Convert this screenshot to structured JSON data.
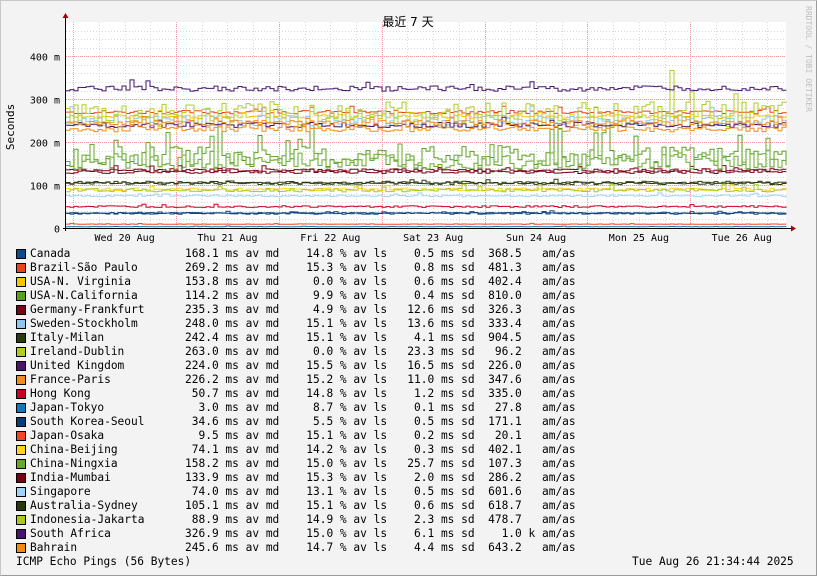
{
  "chart_data": {
    "type": "line",
    "title": "最近 7 天",
    "ylabel": "Seconds",
    "watermark": "RRDTOOL / TOBI OETIKER",
    "y_ticks": [
      "0",
      "100 m",
      "200 m",
      "300 m",
      "400 m"
    ],
    "ylim": [
      0,
      0.48
    ],
    "x_ticks": [
      "Wed 20 Aug",
      "Thu 21 Aug",
      "Fri 22 Aug",
      "Sat 23 Aug",
      "Sun 24 Aug",
      "Mon 25 Aug",
      "Tue 26 Aug"
    ],
    "grid": true,
    "legend_position": "bottom",
    "series": [
      {
        "name": "Canada",
        "color": "#0d4b8c",
        "text": "168.1 ms av md    14.8 % av ls    0.5 ms sd  368.5   am/as",
        "base": 0.034,
        "noise": 0.002
      },
      {
        "name": "Brazil-São Paulo",
        "color": "#e8441c",
        "text": "269.2 ms av md    15.3 % av ls    0.8 ms sd  481.3   am/as",
        "base": 0.27,
        "noise": 0.004
      },
      {
        "name": "USA-N. Virginia",
        "color": "#f0c800",
        "text": "153.8 ms av md     0.0 % av ls    0.6 ms sd  402.4   am/as",
        "base": 0.26,
        "noise": 0.004
      },
      {
        "name": "USA-N.California",
        "color": "#5aa01e",
        "text": "114.2 ms av md     9.9 % av ls    0.4 ms sd  810.0   am/as",
        "base": 0.165,
        "noise": 0.025
      },
      {
        "name": "Germany-Frankfurt",
        "color": "#7d0018",
        "text": "235.3 ms av md     4.9 % av ls   12.6 ms sd  326.3   am/as",
        "base": 0.135,
        "noise": 0.003
      },
      {
        "name": "Sweden-Stockholm",
        "color": "#8ec6f0",
        "text": "248.0 ms av md    15.1 % av ls   13.6 ms sd  333.4   am/as",
        "base": 0.25,
        "noise": 0.012
      },
      {
        "name": "Italy-Milan",
        "color": "#2b3c0c",
        "text": "242.4 ms av md    15.1 % av ls    4.1 ms sd  904.5   am/as",
        "base": 0.105,
        "noise": 0.004
      },
      {
        "name": "Ireland-Dublin",
        "color": "#b2cc20",
        "text": "263.0 ms av md     0.0 % av ls   23.3 ms sd   96.2   am/as",
        "base": 0.265,
        "noise": 0.03
      },
      {
        "name": "United Kingdom",
        "color": "#4b1464",
        "text": "224.0 ms av md    15.5 % av ls   16.5 ms sd  226.0   am/as",
        "base": 0.24,
        "noise": 0.006
      },
      {
        "name": "France-Paris",
        "color": "#f08c1e",
        "text": "226.2 ms av md    15.2 % av ls   11.0 ms sd  347.6   am/as",
        "base": 0.245,
        "noise": 0.006
      },
      {
        "name": "Hong Kong",
        "color": "#c8001e",
        "text": " 50.7 ms av md    14.8 % av ls    1.2 ms sd  335.0   am/as",
        "base": 0.05,
        "noise": 0.002
      },
      {
        "name": "Japan-Tokyo",
        "color": "#1478b4",
        "text": "  3.0 ms av md     8.7 % av ls    0.1 ms sd   27.8   am/as",
        "base": 0.003,
        "noise": 0.0005
      },
      {
        "name": "South Korea-Seoul",
        "color": "#0a3c78",
        "text": " 34.6 ms av md     5.5 % av ls    0.5 ms sd  171.1   am/as",
        "base": 0.035,
        "noise": 0.001
      },
      {
        "name": "Japan-Osaka",
        "color": "#f04628",
        "text": "  9.5 ms av md    15.1 % av ls    0.2 ms sd   20.1   am/as",
        "base": 0.009,
        "noise": 0.0005
      },
      {
        "name": "China-Beijing",
        "color": "#ffd21e",
        "text": " 74.1 ms av md    14.2 % av ls    0.3 ms sd  402.1   am/as",
        "base": 0.09,
        "noise": 0.003
      },
      {
        "name": "China-Ningxia",
        "color": "#64aa28",
        "text": "158.2 ms av md    15.0 % av ls   25.7 ms sd  107.3   am/as",
        "base": 0.155,
        "noise": 0.02
      },
      {
        "name": "India-Mumbai",
        "color": "#780014",
        "text": "133.9 ms av md    15.3 % av ls    2.0 ms sd  286.2   am/as",
        "base": 0.13,
        "noise": 0.003
      },
      {
        "name": "Singapore",
        "color": "#a0d2f5",
        "text": " 74.0 ms av md    13.1 % av ls    0.5 ms sd  601.6   am/as",
        "base": 0.075,
        "noise": 0.002
      },
      {
        "name": "Australia-Sydney",
        "color": "#28380a",
        "text": "105.1 ms av md    15.1 % av ls    0.6 ms sd  618.7   am/as",
        "base": 0.105,
        "noise": 0.002
      },
      {
        "name": "Indonesia-Jakarta",
        "color": "#aac81e",
        "text": " 88.9 ms av md    14.9 % av ls    2.3 ms sd  478.7   am/as",
        "base": 0.088,
        "noise": 0.004
      },
      {
        "name": "South Africa",
        "color": "#46146e",
        "text": "326.9 ms av md    15.0 % av ls    6.1 ms sd    1.0 k am/as",
        "base": 0.325,
        "noise": 0.006
      },
      {
        "name": "Bahrain",
        "color": "#f08c14",
        "text": "245.6 ms av md    14.7 % av ls    4.4 ms sd  643.2   am/as",
        "base": 0.23,
        "noise": 0.006
      }
    ]
  },
  "footer": {
    "left": "ICMP Echo Pings (56 Bytes)",
    "right": "Tue Aug 26 21:34:44 2025"
  }
}
